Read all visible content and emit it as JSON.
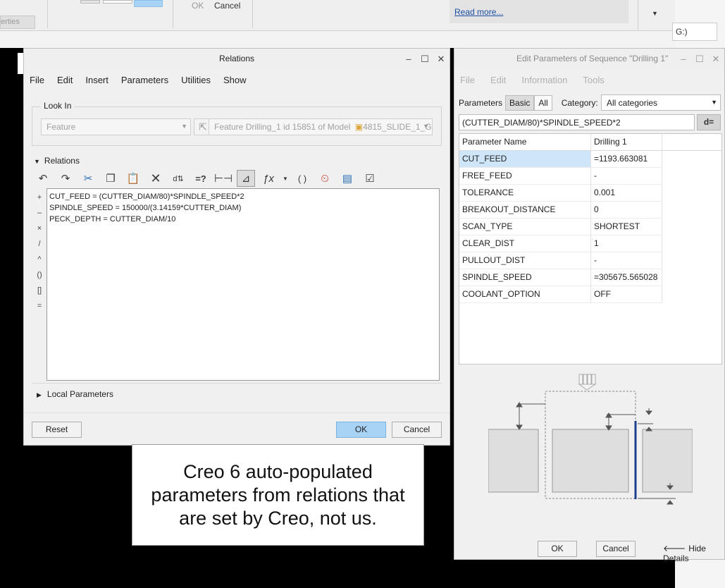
{
  "background": {
    "tab_label": "erties",
    "ok_label": "OK",
    "cancel_label": "Cancel",
    "read_more": "Read more...",
    "right_field": "G:)"
  },
  "relations": {
    "title": "Relations",
    "menu": [
      "File",
      "Edit",
      "Insert",
      "Parameters",
      "Utilities",
      "Show"
    ],
    "look_in_label": "Look In",
    "look_in_type": "Feature",
    "look_in_feature": "Feature Drilling_1 id 15851 of Model",
    "look_in_model": "4815_SLIDE_1_G",
    "section_label": "Relations",
    "operators": [
      "+",
      "–",
      "×",
      "/",
      "^",
      "()",
      "[]",
      "="
    ],
    "lines": [
      "CUT_FEED = (CUTTER_DIAM/80)*SPINDLE_SPEED*2",
      "SPINDLE_SPEED = 150000/(3.14159*CUTTER_DIAM)",
      "PECK_DEPTH = CUTTER_DIAM/10"
    ],
    "local_params_label": "Local Parameters",
    "reset_label": "Reset",
    "ok_label": "OK",
    "cancel_label": "Cancel"
  },
  "edit_params": {
    "title": "Edit Parameters of Sequence \"Drilling 1\"",
    "menu": [
      "File",
      "Edit",
      "Information",
      "Tools"
    ],
    "parameters_label": "Parameters",
    "filter_basic": "Basic",
    "filter_all": "All",
    "category_label": "Category:",
    "category_value": "All categories",
    "expression": "(CUTTER_DIAM/80)*SPINDLE_SPEED*2",
    "d_button": "d=",
    "columns": [
      "Parameter Name",
      "Drilling 1"
    ],
    "rows": [
      {
        "name": "CUT_FEED",
        "value": "=1193.663081"
      },
      {
        "name": "FREE_FEED",
        "value": "-"
      },
      {
        "name": "TOLERANCE",
        "value": "0.001"
      },
      {
        "name": "BREAKOUT_DISTANCE",
        "value": "0"
      },
      {
        "name": "SCAN_TYPE",
        "value": "SHORTEST"
      },
      {
        "name": "CLEAR_DIST",
        "value": "1"
      },
      {
        "name": "PULLOUT_DIST",
        "value": "-"
      },
      {
        "name": "SPINDLE_SPEED",
        "value": "=305675.565028"
      },
      {
        "name": "COOLANT_OPTION",
        "value": "OFF"
      }
    ],
    "ok_label": "OK",
    "cancel_label": "Cancel",
    "hide_details_label": "Hide Details"
  },
  "caption": {
    "line1": "Creo 6 auto-populated",
    "line2": "parameters from relations that",
    "line3": "are set by Creo, not us."
  }
}
